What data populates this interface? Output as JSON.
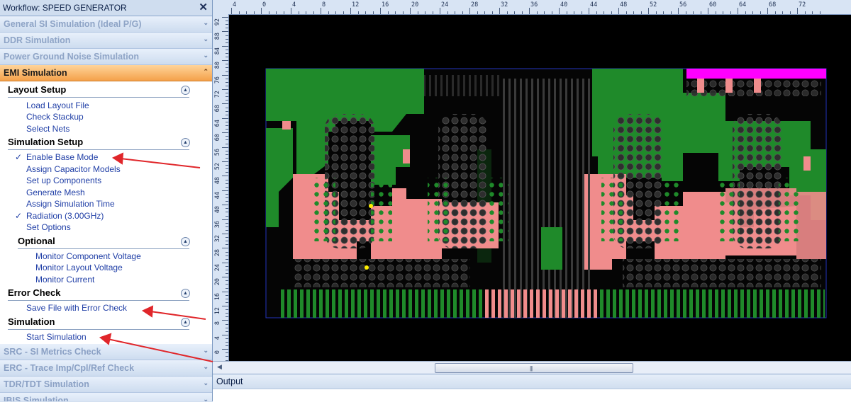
{
  "panel": {
    "title": "Workflow: SPEED GENERATOR",
    "categories_top": [
      "General SI Simulation (Ideal P/G)",
      "DDR Simulation",
      "Power Ground Noise Simulation"
    ],
    "active_category": "EMI Simulation",
    "categories_bottom": [
      "SRC - SI Metrics Check",
      "ERC - Trace Imp/Cpl/Ref Check",
      "TDR/TDT Simulation",
      "IBIS Simulation"
    ]
  },
  "emi": {
    "layout_setup": {
      "title": "Layout Setup",
      "items": [
        "Load Layout File",
        "Check Stackup",
        "Select Nets"
      ]
    },
    "simulation_setup": {
      "title": "Simulation Setup",
      "items": [
        {
          "label": "Enable Base Mode",
          "checked": true
        },
        {
          "label": "Assign Capacitor Models",
          "checked": false
        },
        {
          "label": "Set up Components",
          "checked": false
        },
        {
          "label": "Generate Mesh",
          "checked": false
        },
        {
          "label": "Assign Simulation Time",
          "checked": false
        },
        {
          "label": "Radiation (3.00GHz)",
          "checked": true
        },
        {
          "label": "Set Options",
          "checked": false
        }
      ]
    },
    "optional": {
      "title": "Optional",
      "items": [
        "Monitor Component Voltage",
        "Monitor Layout Voltage",
        "Monitor Current"
      ]
    },
    "error_check": {
      "title": "Error Check",
      "items": [
        "Save File with Error Check"
      ]
    },
    "simulation": {
      "title": "Simulation",
      "items": [
        "Start Simulation"
      ]
    }
  },
  "ruler": {
    "top_labels": [
      "4",
      "0",
      "4",
      "8",
      "12",
      "16",
      "20",
      "24",
      "28",
      "32",
      "36",
      "40",
      "44",
      "48",
      "52",
      "56",
      "60",
      "64",
      "68",
      "72"
    ],
    "left_labels": [
      "92",
      "88",
      "84",
      "80",
      "76",
      "72",
      "68",
      "64",
      "60",
      "56",
      "52",
      "48",
      "44",
      "40",
      "36",
      "32",
      "28",
      "24",
      "20",
      "16",
      "12",
      "8",
      "4",
      "0",
      "-4"
    ]
  },
  "output": {
    "title": "Output"
  },
  "colors": {
    "active_category": "#f4a14a",
    "pcb_green": "#1f8a2a",
    "pcb_pink": "#f08c8c",
    "pcb_magenta": "#ff00ff",
    "annotation_red": "#e0262a"
  }
}
